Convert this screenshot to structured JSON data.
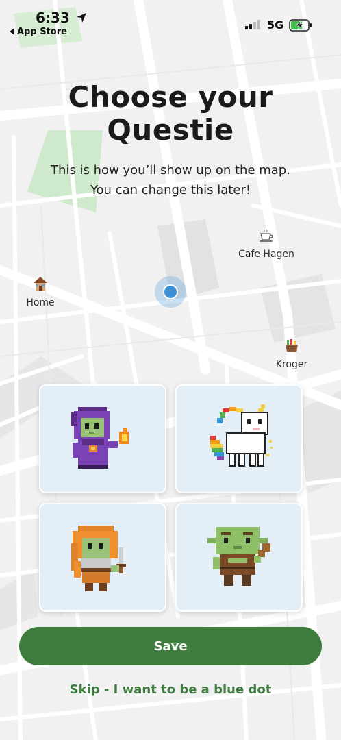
{
  "status_bar": {
    "time": "6:33",
    "back_label": "App Store",
    "network": "5G"
  },
  "header": {
    "title_line1": "Choose your",
    "title_line2": "Questie",
    "subtitle_line1": "This is how you’ll show up on the map.",
    "subtitle_line2": "You can change this later!"
  },
  "map": {
    "places": {
      "home": {
        "label": "Home",
        "icon": "house-icon"
      },
      "cafe": {
        "label": "Cafe Hagen",
        "icon": "coffee-cup-icon"
      },
      "kroger": {
        "label": "Kroger",
        "icon": "grocery-basket-icon"
      }
    },
    "location_marker": "blue-dot"
  },
  "avatars": [
    {
      "icon": "purple-wizard-icon"
    },
    {
      "icon": "rainbow-unicorn-icon"
    },
    {
      "icon": "orange-hooded-warrior-icon"
    },
    {
      "icon": "green-goblin-icon"
    }
  ],
  "actions": {
    "save_label": "Save",
    "skip_label": "Skip - I want to be a blue dot"
  },
  "colors": {
    "accent_green": "#3e7d3e",
    "card_background": "#e3eef7",
    "blue_dot": "#3d8fd4"
  }
}
